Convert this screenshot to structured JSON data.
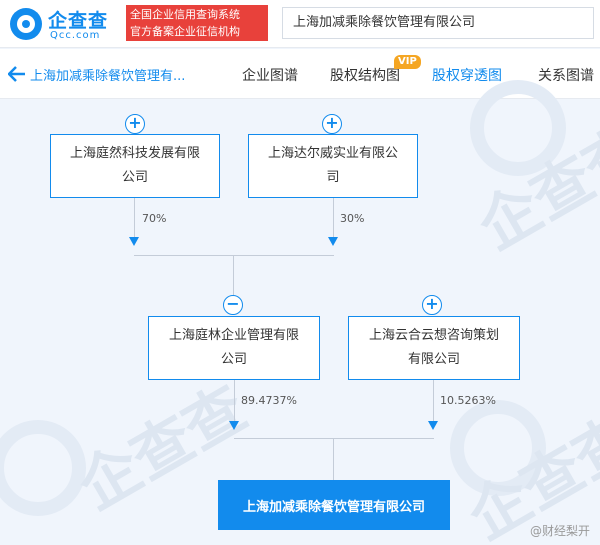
{
  "brand": {
    "name": "企查查",
    "domain": "Qcc.com",
    "certification_line1": "全国企业信用查询系统",
    "certification_line2": "官方备案企业征信机构",
    "primary_color": "#128bed",
    "cert_color": "#e8413b"
  },
  "search": {
    "value": "上海加减乘除餐饮管理有限公司"
  },
  "nav": {
    "back_icon": "left-arrow-icon",
    "company": "上海加减乘除餐饮管理有...",
    "tabs": [
      {
        "label": "企业图谱",
        "active": false
      },
      {
        "label": "股权结构图",
        "active": false,
        "badge": "VIP"
      },
      {
        "label": "股权穿透图",
        "active": true
      },
      {
        "label": "关系图谱",
        "active": false
      }
    ]
  },
  "chart_data": {
    "type": "equity-penetration-diagram",
    "top_shareholders": [
      {
        "name": "上海庭然科技发展有限公司",
        "line1": "上海庭然科技发展有限",
        "line2": "公司",
        "percent": "70%",
        "toggle": "+"
      },
      {
        "name": "上海达尔威实业有限公司",
        "line1": "上海达尔威实业有限公",
        "line2": "司",
        "percent": "30%",
        "toggle": "+"
      }
    ],
    "mid_shareholders": [
      {
        "name": "上海庭林企业管理有限公司",
        "line1": "上海庭林企业管理有限",
        "line2": "公司",
        "percent": "89.4737%",
        "toggle": "−"
      },
      {
        "name": "上海云合云想咨询策划有限公司",
        "line1": "上海云合云想咨询策划",
        "line2": "有限公司",
        "percent": "10.5263%",
        "toggle": "+"
      }
    ],
    "target": "上海加减乘除餐饮管理有限公司"
  },
  "watermark_text": "企查查",
  "source_label": "@财经梨开"
}
